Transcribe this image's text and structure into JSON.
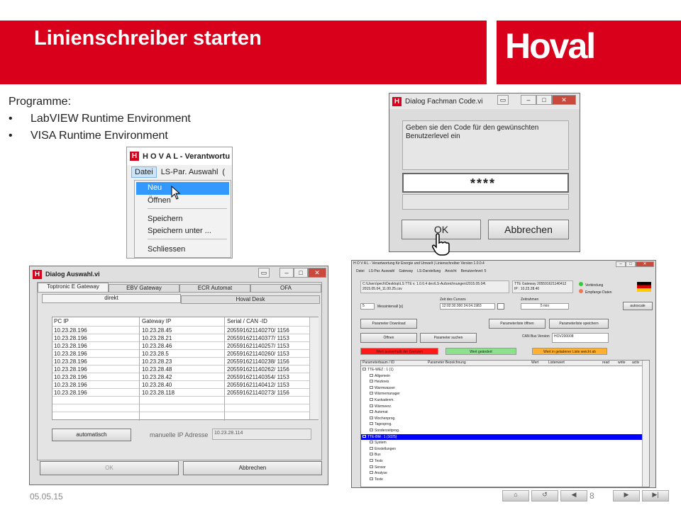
{
  "header": {
    "title": "Linienschreiber starten",
    "logo": "Hoval",
    "accent": "#d9001b"
  },
  "intro": {
    "heading": "Programme:",
    "items": [
      "LabVIEW Runtime Environment",
      "VISA Runtime Environment"
    ]
  },
  "menu_shot": {
    "title": "H O V A L -  Verantwortu",
    "menubar": [
      "Datei",
      "LS-Par. Auswahl",
      "("
    ],
    "items": [
      "Neu",
      "Öffnen",
      "Speichern",
      "Speichern unter ...",
      "Schliessen"
    ]
  },
  "code_dialog": {
    "title": "Dialog Fachman Code.vi",
    "message": "Geben sie den Code für den gewünschten Benutzerlevel ein",
    "code": "****",
    "ok": "OK",
    "cancel": "Abbrechen"
  },
  "auswahl": {
    "title": "Dialog Auswahl.vi",
    "tabs": [
      "Toptronic E Gateway",
      "EBV Gateway",
      "ECR Automat",
      "OFA"
    ],
    "subtabs": [
      "direkt",
      "Hoval Desk"
    ],
    "columns": [
      "PC IP",
      "Gateway IP",
      "Serial / CAN -ID"
    ],
    "rows": [
      [
        "10.23.28.196",
        "10.23.28.45",
        "205591621140270/ 1156"
      ],
      [
        "10.23.28.196",
        "10.23.28.21",
        "205591621140377/ 1153"
      ],
      [
        "10.23.28.196",
        "10.23.28.46",
        "205591621140257/ 1153"
      ],
      [
        "10.23.28.196",
        "10.23.28.5",
        "205591621140260/ 1153"
      ],
      [
        "10.23.28.196",
        "10.23.28.23",
        "205591621140238/ 1156"
      ],
      [
        "10.23.28.196",
        "10.23.28.48",
        "205591621140262/ 1156"
      ],
      [
        "10.23.28.196",
        "10.23.28.42",
        "205591621140354/ 1153"
      ],
      [
        "10.23.28.196",
        "10.23.28.40",
        "205591621140412/ 1153"
      ],
      [
        "10.23.28.196",
        "10.23.28.118",
        "205591621140273/ 1156"
      ]
    ],
    "auto_button": "automatisch",
    "manual_label": "manuelle IP Adresse",
    "manual_value": "10.23.28.114",
    "ok": "OK",
    "cancel": "Abbrechen"
  },
  "ls": {
    "title": "H O V A L - Verantwortung für Energie und Umwelt | Linienschreiber Version 1.0.0.4",
    "menu": [
      "Datei",
      "LS-Par. Auswahl",
      "Gateway",
      "LS-Darstellung",
      "Ansicht",
      "Benutzerlevel: 5"
    ],
    "path": "C:\\Users\\pech\\Desktop\\LS TTE v. 1.0.0.4 dev\\LS-Aufzeichnungen\\2015.05.04\\ 2015.05.04_11.00.25.csv",
    "gateway": "TTE Gateway 205591621140412",
    "ip": "IP : 10.23.28.40",
    "status": [
      "Verbindung",
      "Empfange Daten"
    ],
    "interval_value": "5",
    "interval_label": "Messintervall [s]",
    "cursor_label": "Zeit des Cursors",
    "cursor_value": "12:02:30.000 24.04.1983",
    "zoom_label": "Zeitrahmen",
    "zoom_value": "5 min",
    "autoscale": "autoscale",
    "btn_download": "Parameter Download",
    "btn_open_list": "Parameterliste öffnen",
    "btn_save_list": "Parameterliste speichern",
    "btn_open": "Öffnen",
    "btn_search": "Parameter suchen",
    "can_label": "CAN Bus Version",
    "can_value": "HOV200008",
    "legend": [
      {
        "text": "Wert ausserhalb der Grenzen",
        "color": "#ff1a1a"
      },
      {
        "text": "Wert geändert",
        "color": "#8de08d"
      },
      {
        "text": "Wert in geladener Liste weicht ab",
        "color": "#ffb030"
      }
    ],
    "columns": [
      "Parameterbaum / ID",
      "Parameter Bezeichnung",
      "Wert",
      "Listenwert",
      "read",
      "write",
      "activ"
    ],
    "tree": [
      "TTE-WEZ : 1 (1)",
      "Allgemein",
      "Heizkreis",
      "Warmwasser",
      "Wärmemanager",
      "Kaskadenm.",
      "Wärmeerz.",
      "Automat",
      "Wochenprog.",
      "Tagesprog.",
      "Sonderzeitprog.",
      "TTE-BM : 1 (1025)",
      "System",
      "Einstellungen",
      "Bus",
      "Tests",
      "Sensor",
      "Analyse",
      "Texte"
    ],
    "tree_level": [
      0,
      1,
      1,
      1,
      1,
      1,
      1,
      1,
      1,
      1,
      1,
      0,
      1,
      1,
      1,
      1,
      1,
      1,
      1
    ],
    "selected_index": 11
  },
  "footer": {
    "date": "05.05.15",
    "page": "8"
  }
}
